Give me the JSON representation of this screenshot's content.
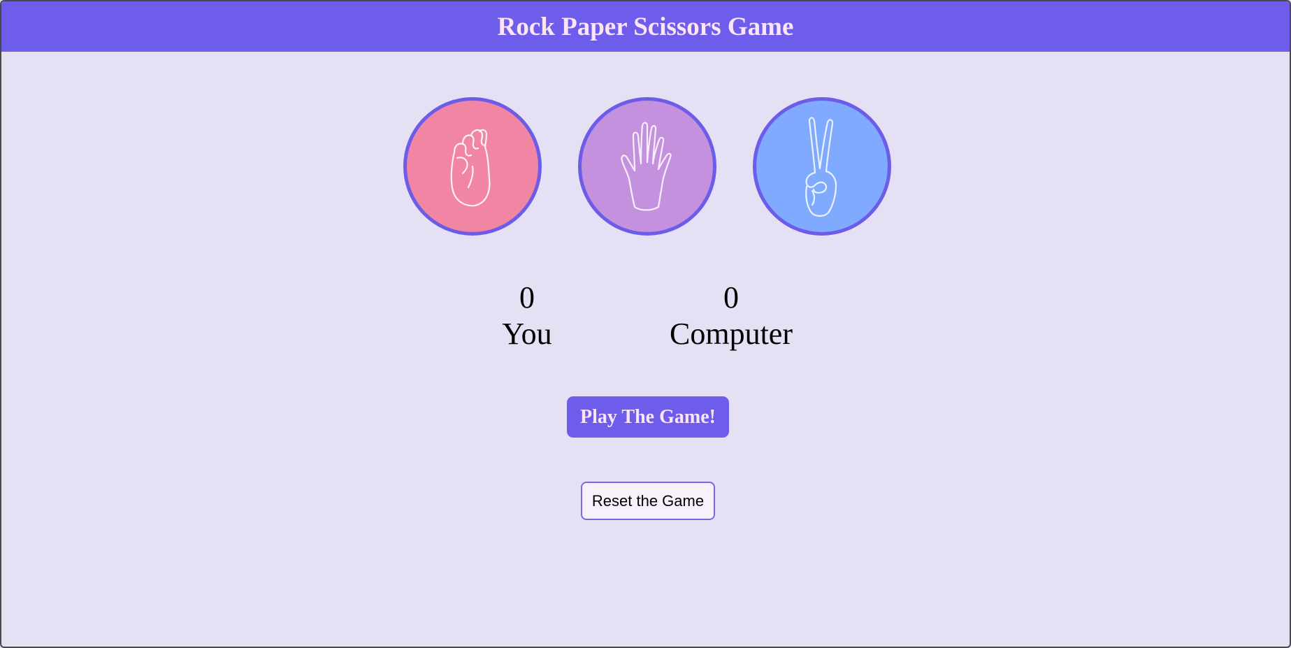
{
  "header": {
    "title": "Rock Paper Scissors Game"
  },
  "choices": [
    {
      "id": "rock",
      "icon": "rock-hand-icon",
      "color": "#f086a3"
    },
    {
      "id": "paper",
      "icon": "paper-hand-icon",
      "color": "#c391de"
    },
    {
      "id": "scissors",
      "icon": "scissors-hand-icon",
      "color": "#80aafe"
    }
  ],
  "scoreboard": {
    "user": {
      "score": "0",
      "label": "You"
    },
    "computer": {
      "score": "0",
      "label": "Computer"
    }
  },
  "buttons": {
    "play_label": "Play The Game!",
    "reset_label": "Reset the Game"
  },
  "colors": {
    "accent": "#6e5deb",
    "background": "#e5e0f4",
    "header_text": "#fbe4f4"
  }
}
